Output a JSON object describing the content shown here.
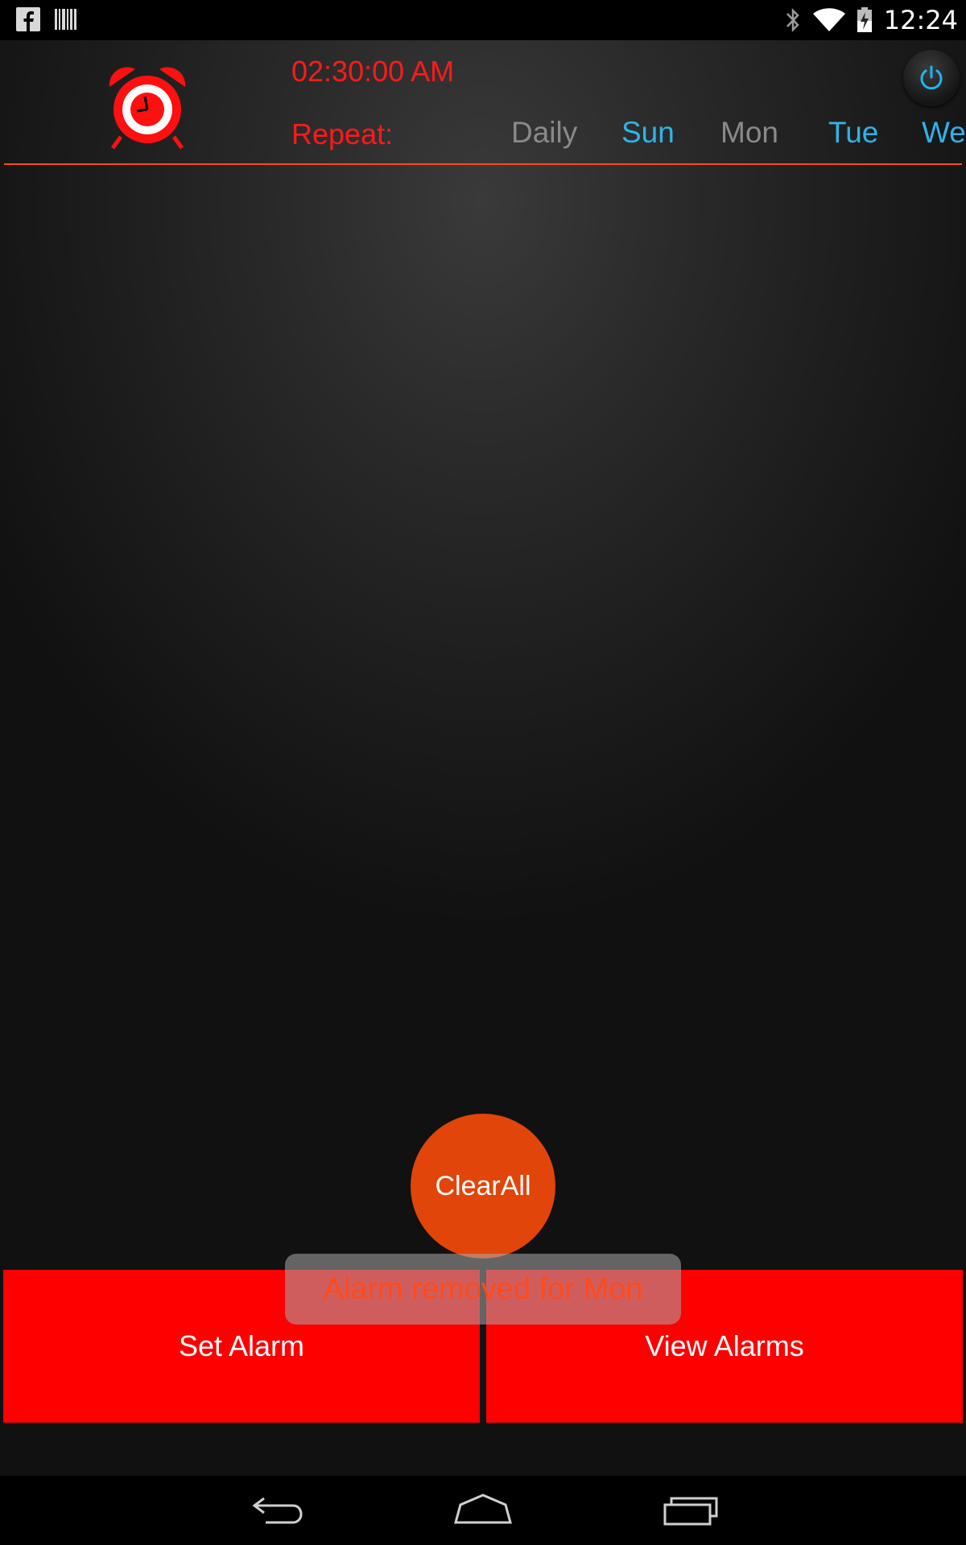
{
  "status_bar": {
    "time": "12:24",
    "left_icons": [
      "facebook-icon",
      "barcode-icon"
    ],
    "right_icons": [
      "bluetooth-icon",
      "wifi-icon",
      "battery-icon"
    ]
  },
  "alarm": {
    "time": "02:30:00 AM",
    "repeat_label": "Repeat:",
    "days": [
      {
        "label": "Daily",
        "active": false
      },
      {
        "label": "Sun",
        "active": true
      },
      {
        "label": "Mon",
        "active": false
      },
      {
        "label": "Tue",
        "active": true
      },
      {
        "label": "We",
        "active": true
      }
    ],
    "power_icon": "power-icon"
  },
  "actions": {
    "clear_all_label": "ClearAll",
    "set_alarm_label": "Set Alarm",
    "view_alarms_label": "View Alarms"
  },
  "toast": {
    "message": "Alarm removed for Mon"
  },
  "nav_bar": {
    "icons": [
      "back-icon",
      "home-icon",
      "recents-icon"
    ]
  },
  "colors": {
    "accent_red": "#ff0000",
    "text_red": "#ff1a1a",
    "fab_orange": "#e2450a",
    "day_active": "#2fb3e8",
    "day_inactive": "#8a8a8a",
    "divider": "#ff4a10"
  }
}
